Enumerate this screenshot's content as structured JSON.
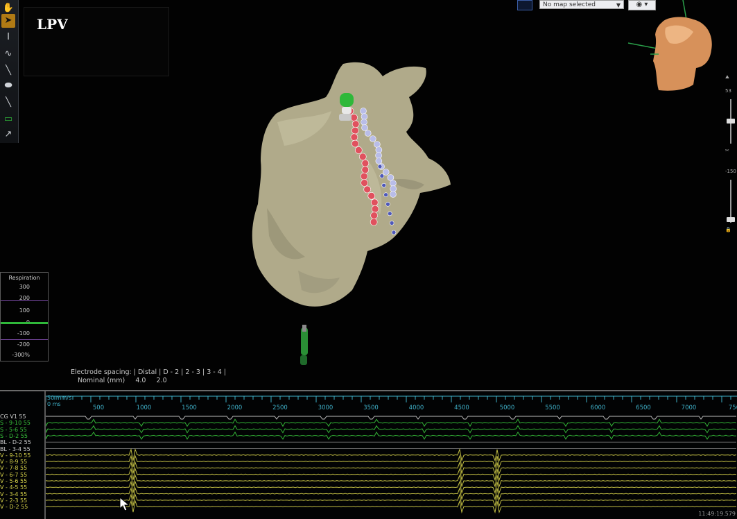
{
  "toolbar": {
    "tools": [
      {
        "name": "pan-tool",
        "icon": "hand-icon",
        "glyph": "✋"
      },
      {
        "name": "select-tool",
        "icon": "arrow-pointer-icon",
        "glyph": "➤",
        "active": true
      },
      {
        "name": "measure-tool",
        "icon": "text-cursor-icon",
        "glyph": "I"
      },
      {
        "name": "curve-tool",
        "icon": "curve-icon",
        "glyph": "∿"
      },
      {
        "name": "catheter-tool",
        "icon": "catheter-icon",
        "glyph": "╲"
      },
      {
        "name": "ablation-tool",
        "icon": "capsule-icon",
        "glyph": "⬬"
      },
      {
        "name": "probe-tool",
        "icon": "probe-icon",
        "glyph": "╲"
      },
      {
        "name": "battery-tool",
        "icon": "battery-icon",
        "glyph": "▭"
      },
      {
        "name": "curve-select-tool",
        "icon": "curve-arrow-icon",
        "glyph": "↗"
      }
    ]
  },
  "map_label": "LPV",
  "map_selector": {
    "value": "No map selected"
  },
  "eye_button": {
    "icon": "eye-icon"
  },
  "right_controls": {
    "top_value": "53",
    "bottom_value": "-150"
  },
  "respiration": {
    "title": "Respiration",
    "ticks": [
      "300",
      "200",
      "100",
      "0",
      "-100",
      "-200",
      "-300%"
    ]
  },
  "electrode_spacing": {
    "line1": "Electrode spacing: | Distal | D - 2 | 2 - 3 | 3 - 4 |",
    "line2": "Nominal (mm)     4.0     2.0"
  },
  "egm": {
    "speed": "50 mm/s",
    "start": "0 ms",
    "ruler_ticks": [
      "500",
      "1000",
      "1500",
      "2000",
      "2500",
      "3000",
      "3500",
      "4000",
      "4500",
      "5000",
      "5500",
      "6000",
      "6500",
      "7000",
      "750"
    ],
    "channels": [
      {
        "label": "CG V1 55",
        "color": "#d0d0d0"
      },
      {
        "label": "S - 9-10 55",
        "color": "#39c63c"
      },
      {
        "label": "S - 5-6 55",
        "color": "#39c63c"
      },
      {
        "label": "S - D-2 55",
        "color": "#39c63c"
      },
      {
        "label": "BL - D-2 55",
        "color": "#d0d0d0"
      },
      {
        "label": "BL - 3-4 55",
        "color": "#d0d0d0"
      },
      {
        "label": "V - 9-10 55",
        "color": "#d6d24a"
      },
      {
        "label": "V - 8-9 55",
        "color": "#d6d24a"
      },
      {
        "label": "V - 7-8 55",
        "color": "#d6d24a"
      },
      {
        "label": "V - 6-7 55",
        "color": "#d6d24a"
      },
      {
        "label": "V - 5-6 55",
        "color": "#d6d24a"
      },
      {
        "label": "V - 4-5 55",
        "color": "#d6d24a"
      },
      {
        "label": "V - 3-4 55",
        "color": "#d6d24a"
      },
      {
        "label": "V - 2-3 55",
        "color": "#d6d24a"
      },
      {
        "label": "V - D-2 55",
        "color": "#d6d24a"
      }
    ],
    "timestamp": "11:49:19.579"
  },
  "colors": {
    "anatomy": "#b3ad8e",
    "ablation_red": "#e0515e",
    "ablation_lavender": "#b9bde8",
    "ablation_blue": "#4e58b8",
    "catheter_green": "#2fb83a",
    "ruler_cyan": "#3fb0c8",
    "tool_active": "#b07a14"
  }
}
